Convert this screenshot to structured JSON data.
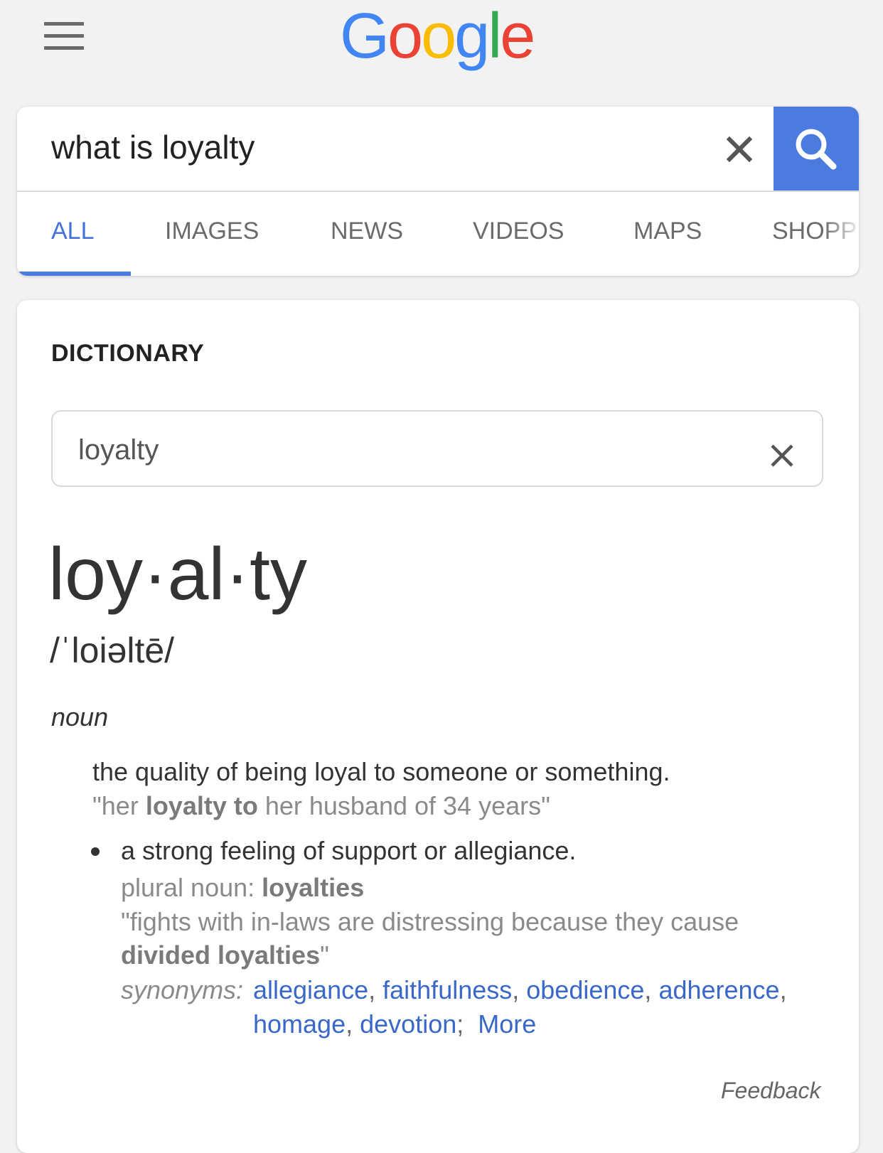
{
  "header": {
    "logo_letters": [
      "G",
      "o",
      "o",
      "g",
      "l",
      "e"
    ],
    "logo_colors": [
      "#4285f4",
      "#ea4335",
      "#fbbc05",
      "#4285f4",
      "#34a853",
      "#ea4335"
    ]
  },
  "search": {
    "query": "what is loyalty",
    "accent_color": "#4c7be0"
  },
  "tabs": [
    {
      "label": "ALL",
      "active": true
    },
    {
      "label": "IMAGES",
      "active": false
    },
    {
      "label": "NEWS",
      "active": false
    },
    {
      "label": "VIDEOS",
      "active": false
    },
    {
      "label": "MAPS",
      "active": false
    },
    {
      "label": "SHOPP",
      "active": false
    }
  ],
  "dictionary": {
    "title": "DICTIONARY",
    "search_value": "loyalty",
    "headword": "loy·al·ty",
    "phonetic": "/ˈloiəltē/",
    "part_of_speech": "noun",
    "definition_1": "the quality of being loyal to someone or something.",
    "example_1": {
      "before": "\"her ",
      "bold": "loyalty to",
      "after": " her husband of 34 years\""
    },
    "definition_2": "a strong feeling of support or allegiance.",
    "plural_label": "plural noun: ",
    "plural_value": "loyalties",
    "example_2_line1": "\"fights with in-laws are distressing because they cause",
    "example_2_bold": "divided loyalties",
    "example_2_end": "\"",
    "synonyms_label": "synonyms:",
    "synonyms": [
      "allegiance",
      "faithfulness",
      "obedience",
      "adherence",
      "homage",
      "devotion"
    ],
    "more_label": "More",
    "feedback": "Feedback"
  }
}
